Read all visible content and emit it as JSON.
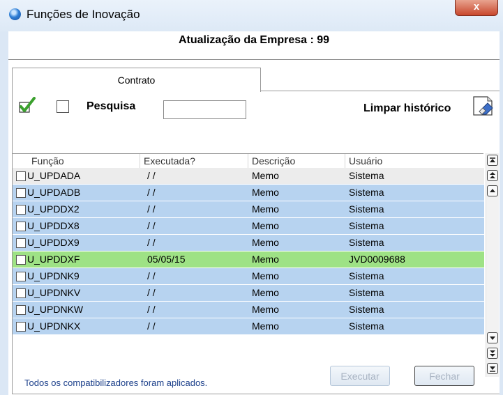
{
  "window": {
    "title": "Funções de Inovação",
    "close_label": "x"
  },
  "header": {
    "empresa_label": "Atualização da Empresa : 99"
  },
  "tabs": [
    {
      "label": "Contrato"
    }
  ],
  "toolbar": {
    "pesquisa_label": "Pesquisa",
    "search_value": "",
    "limpar_label": "Limpar histórico"
  },
  "grid": {
    "columns": [
      "Função",
      "Executada?",
      "Descrição",
      "Usuário"
    ],
    "rows": [
      {
        "funcao": "U_UPDADA",
        "executada": " / /",
        "descricao": "Memo",
        "usuario": "Sistema",
        "state": "normal"
      },
      {
        "funcao": "U_UPDADB",
        "executada": " / /",
        "descricao": "Memo",
        "usuario": "Sistema",
        "state": "pending"
      },
      {
        "funcao": "U_UPDDX2",
        "executada": " / /",
        "descricao": "Memo",
        "usuario": "Sistema",
        "state": "pending"
      },
      {
        "funcao": "U_UPDDX8",
        "executada": " / /",
        "descricao": "Memo",
        "usuario": "Sistema",
        "state": "pending"
      },
      {
        "funcao": "U_UPDDX9",
        "executada": " / /",
        "descricao": "Memo",
        "usuario": "Sistema",
        "state": "pending"
      },
      {
        "funcao": "U_UPDDXF",
        "executada": "05/05/15",
        "descricao": "Memo",
        "usuario": "JVD0009688",
        "state": "executed"
      },
      {
        "funcao": "U_UPDNK9",
        "executada": " / /",
        "descricao": "Memo",
        "usuario": "Sistema",
        "state": "pending"
      },
      {
        "funcao": "U_UPDNKV",
        "executada": " / /",
        "descricao": "Memo",
        "usuario": "Sistema",
        "state": "pending"
      },
      {
        "funcao": "U_UPDNKW",
        "executada": " / /",
        "descricao": "Memo",
        "usuario": "Sistema",
        "state": "pending"
      },
      {
        "funcao": "U_UPDNKX",
        "executada": " / /",
        "descricao": "Memo",
        "usuario": "Sistema",
        "state": "pending"
      }
    ]
  },
  "status": {
    "message": "Todos os compatibilizadores foram aplicados."
  },
  "buttons": {
    "executar_label": "Executar",
    "fechar_label": "Fechar"
  },
  "colors": {
    "row_normal": "#ececec",
    "row_pending": "#b7d3f0",
    "row_executed": "#9ee285",
    "accent": "#2f7fd6"
  },
  "icons": {
    "title": "globe-icon",
    "select_all": "green-check-icon",
    "clear": "eraser-icon"
  }
}
